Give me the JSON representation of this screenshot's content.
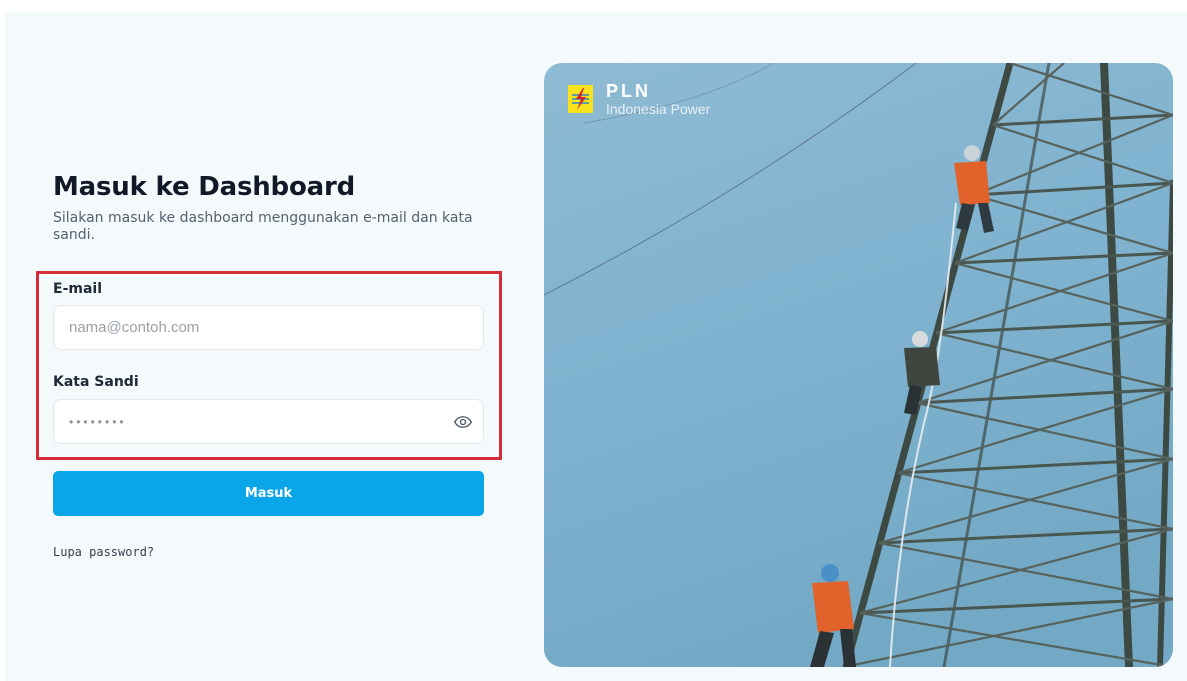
{
  "login": {
    "title": "Masuk ke Dashboard",
    "subtitle": "Silakan masuk ke dashboard menggunakan e-mail dan kata sandi.",
    "email": {
      "label": "E-mail",
      "placeholder": "nama@contoh.com",
      "value": ""
    },
    "password": {
      "label": "Kata Sandi",
      "value": "password",
      "icon": "eye-icon"
    },
    "submit_label": "Masuk",
    "forgot_label": "Lupa password?"
  },
  "brand": {
    "name": "PLN",
    "subtitle": "Indonesia Power",
    "logo_icon": "pln-lightning-logo"
  },
  "colors": {
    "primary": "#0ba5e9",
    "highlight": "#d62b38",
    "background": "#f4fafb",
    "sky": "#7fb3cf",
    "logo_yellow": "#f8e21c",
    "logo_red": "#d2232a"
  }
}
